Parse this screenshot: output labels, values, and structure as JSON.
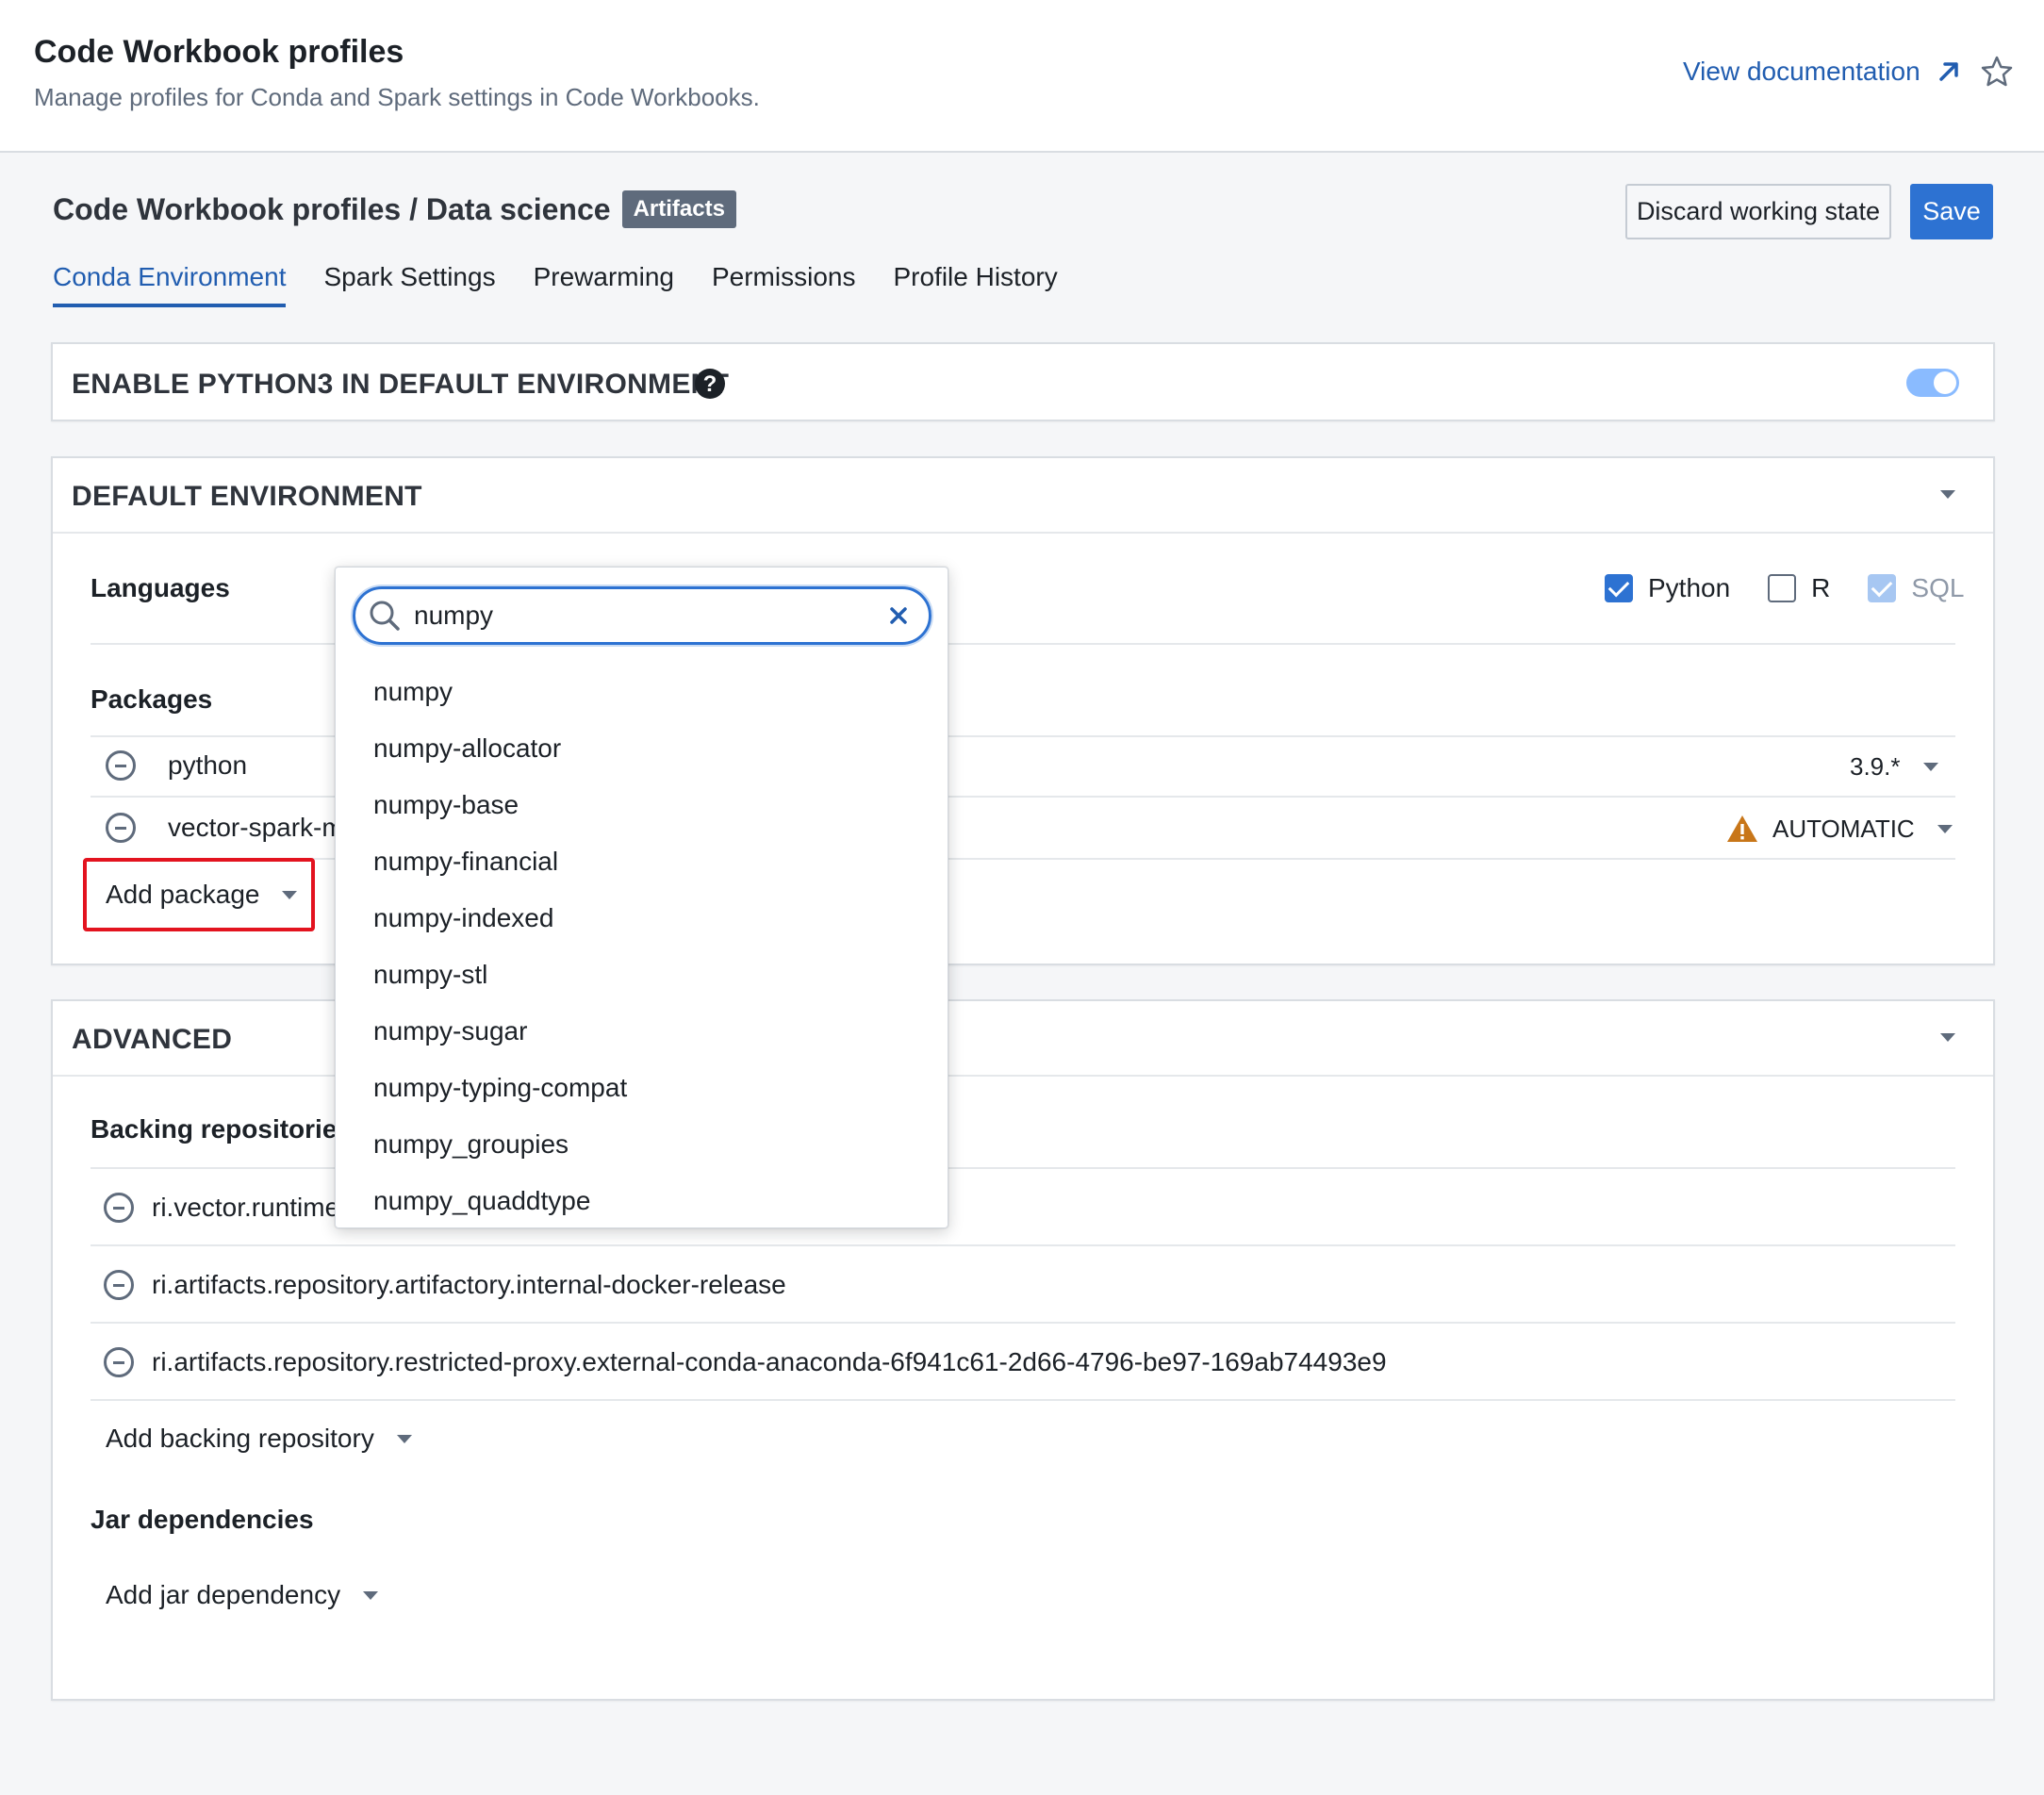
{
  "header": {
    "title": "Code Workbook profiles",
    "subtitle": "Manage profiles for Conda and Spark settings in Code Workbooks.",
    "doc_link": "View documentation"
  },
  "breadcrumb": {
    "root": "Code Workbook profiles",
    "separator": " / ",
    "current": "Data science",
    "badge": "Artifacts"
  },
  "actions": {
    "discard": "Discard working state",
    "save": "Save"
  },
  "tabs": [
    {
      "label": "Conda Environment",
      "active": true
    },
    {
      "label": "Spark Settings",
      "active": false
    },
    {
      "label": "Prewarming",
      "active": false
    },
    {
      "label": "Permissions",
      "active": false
    },
    {
      "label": "Profile History",
      "active": false
    }
  ],
  "python3_section": {
    "title": "ENABLE PYTHON3 IN DEFAULT ENVIRONMENT",
    "enabled": true
  },
  "default_env": {
    "title": "DEFAULT ENVIRONMENT",
    "languages_label": "Languages",
    "languages": [
      {
        "label": "Python",
        "checked": true,
        "disabled": false
      },
      {
        "label": "R",
        "checked": false,
        "disabled": false
      },
      {
        "label": "SQL",
        "checked": true,
        "disabled": true
      }
    ],
    "packages_label": "Packages",
    "packages": [
      {
        "name": "python",
        "version": "3.9.*"
      },
      {
        "name": "vector-spark-m",
        "version": "AUTOMATIC",
        "warning": true
      }
    ],
    "add_package": "Add package"
  },
  "advanced": {
    "title": "ADVANCED",
    "backing_label": "Backing repositories",
    "repositories": [
      "ri.vector.runtime",
      "ri.artifacts.repository.artifactory.internal-docker-release",
      "ri.artifacts.repository.restricted-proxy.external-conda-anaconda-6f941c61-2d66-4796-be97-169ab74493e9"
    ],
    "add_repository": "Add backing repository",
    "jar_label": "Jar dependencies",
    "add_jar": "Add jar dependency"
  },
  "package_search": {
    "query": "numpy",
    "results": [
      "numpy",
      "numpy-allocator",
      "numpy-base",
      "numpy-financial",
      "numpy-indexed",
      "numpy-stl",
      "numpy-sugar",
      "numpy-typing-compat",
      "numpy_groupies",
      "numpy_quaddtype"
    ]
  },
  "colors": {
    "accent": "#2d72d2",
    "link": "#215db0",
    "highlight_border": "#e3131f",
    "warning": "#c87619"
  }
}
